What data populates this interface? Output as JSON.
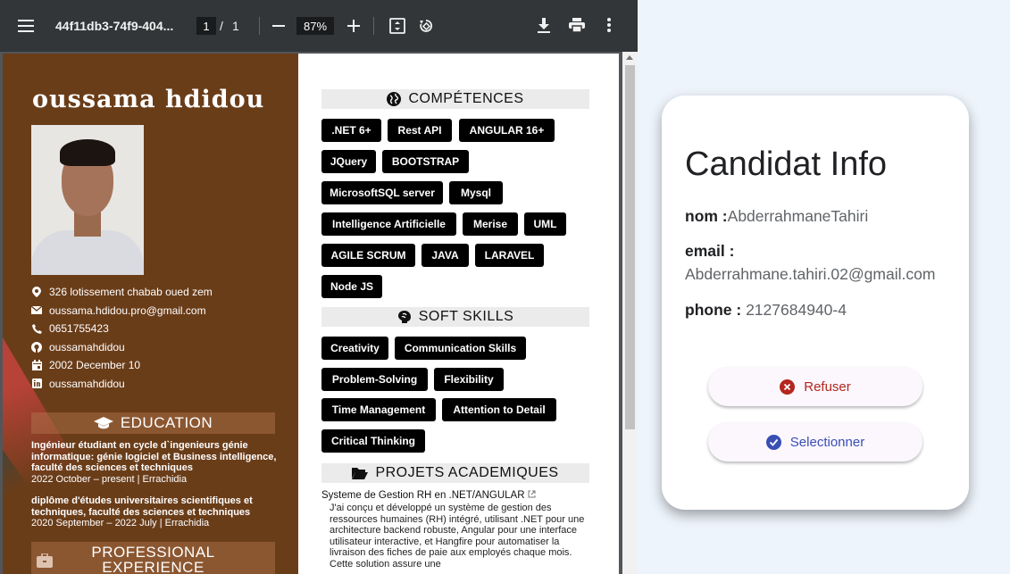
{
  "viewer": {
    "doc_title": "44f11db3-74f9-404...",
    "page_current": "1",
    "page_sep": "/",
    "page_total": "1",
    "zoom": "87%"
  },
  "cv": {
    "name": "oussama hdidou",
    "contacts": [
      {
        "icon": "location-icon",
        "text": "326 lotissement chabab oued zem"
      },
      {
        "icon": "mail-icon",
        "text": "oussama.hdidou.pro@gmail.com"
      },
      {
        "icon": "phone-icon",
        "text": "0651755423"
      },
      {
        "icon": "github-icon",
        "text": "oussamahdidou"
      },
      {
        "icon": "calendar-icon",
        "text": "2002 December 10"
      },
      {
        "icon": "linkedin-icon",
        "text": "oussamahdidou"
      }
    ],
    "education_heading": "EDUCATION",
    "education": [
      {
        "title": "Ingénieur étudiant en cycle d`ingenieurs génie informatique: génie logiciel et Business intelligence, faculté des sciences et techniques",
        "period": "2022 October – present | Errachidia"
      },
      {
        "title": "diplôme d'études universitaires scientifiques et techniques, faculté des sciences et techniques",
        "period": "2020 September – 2022 July | Errachidia"
      }
    ],
    "experience_heading_1": "PROFESSIONAL",
    "experience_heading_2": "EXPERIENCE",
    "skills_heading": "COMPÉTENCES",
    "skills": [
      ".NET 6+",
      "Rest API",
      "ANGULAR 16+",
      "JQuery",
      "BOOTSTRAP",
      "MicrosoftSQL server",
      "Mysql",
      "Intelligence Artificielle",
      "Merise",
      "UML",
      "AGILE SCRUM",
      "JAVA",
      "LARAVEL",
      "Node JS"
    ],
    "soft_heading": "SOFT SKILLS",
    "soft_skills": [
      "Creativity",
      "Communication Skills",
      "Problem-Solving",
      "Flexibility",
      "Time Management",
      "Attention to Detail",
      "Critical Thinking"
    ],
    "projects_heading": "PROJETS ACADEMIQUES",
    "project_title": "Systeme de Gestion RH en .NET/ANGULAR",
    "project_desc": "J'ai conçu et développé un système de gestion des ressources humaines (RH) intégré, utilisant .NET pour une architecture backend robuste, Angular pour une interface utilisateur interactive, et Hangfire pour automatiser la livraison des fiches de paie aux employés chaque mois. Cette solution assure une"
  },
  "card": {
    "title": "Candidat Info",
    "nom_label": "nom :",
    "nom_value": "AbderrahmaneTahiri",
    "email_label": "email :",
    "email_value": "Abderrahmane.tahiri.02@gmail.com",
    "phone_label": "phone :",
    "phone_value": "2127684940-4",
    "refuse_label": "Refuser",
    "select_label": "Selectionner"
  },
  "colors": {
    "refuse": "#b3261e",
    "select": "#3a4fb4",
    "cv_brown": "#6a3d19",
    "toolbar": "#323639"
  }
}
